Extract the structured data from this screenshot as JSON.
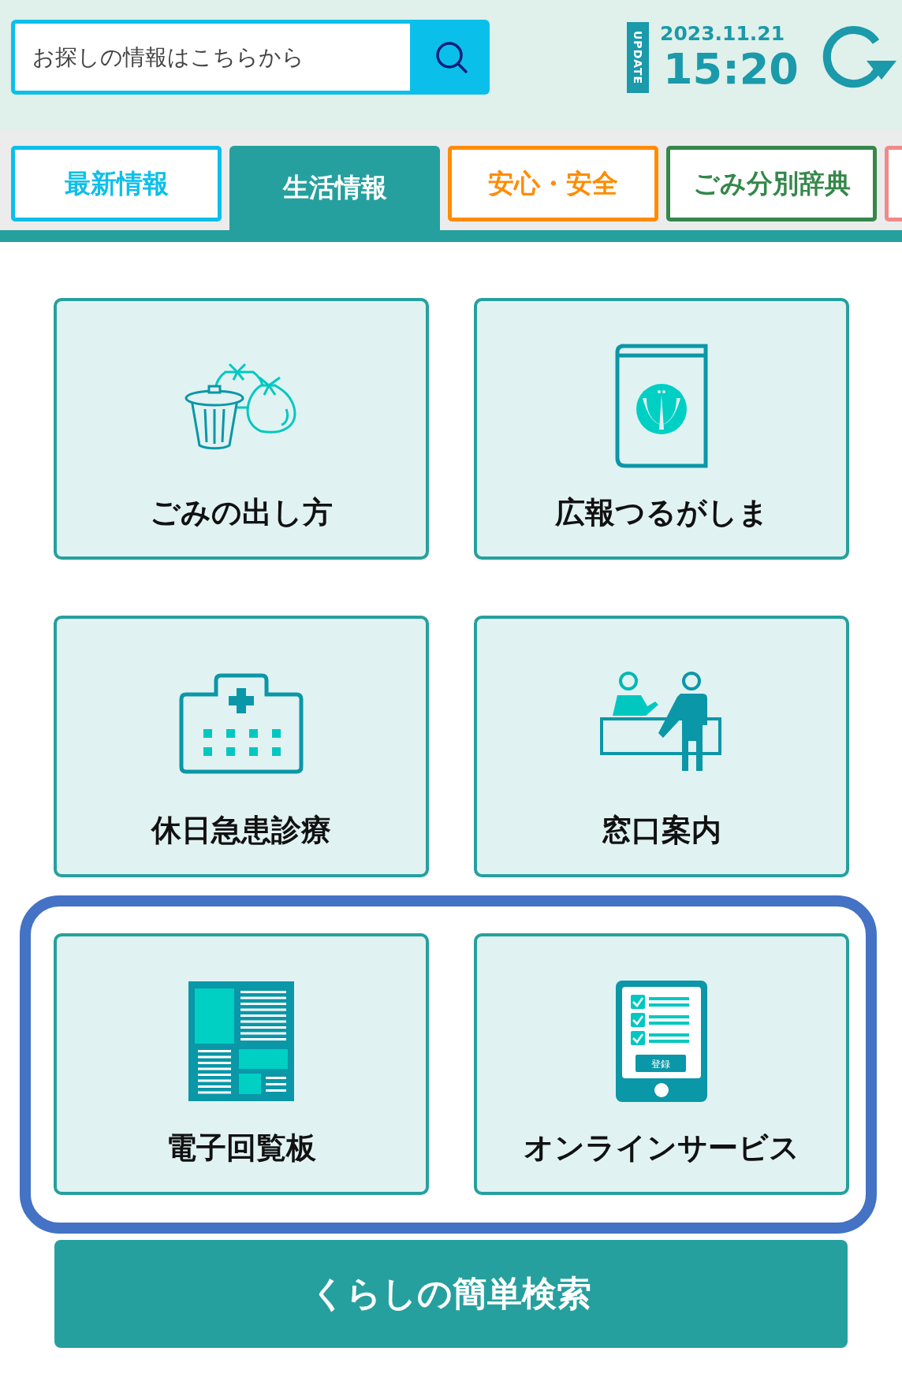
{
  "search": {
    "placeholder": "お探しの情報はこちらから"
  },
  "update": {
    "badge": "UPDATE",
    "date": "2023.11.21",
    "time": "15:20"
  },
  "tabs": [
    {
      "label": "最新情報",
      "selected": false,
      "color": "#0bbfeb"
    },
    {
      "label": "生活情報",
      "selected": true,
      "color": "#26a09e"
    },
    {
      "label": "安心・安全",
      "selected": false,
      "color": "#ff8c00"
    },
    {
      "label": "ごみ分別辞典",
      "selected": false,
      "color": "#35874a"
    },
    {
      "selected": false,
      "color": "#f08a8a"
    }
  ],
  "card_rows": [
    {
      "highlighted": false,
      "cards": [
        {
          "kind": "garbage",
          "label": "ごみの出し方"
        },
        {
          "kind": "magazine",
          "label": "広報つるがしま"
        }
      ]
    },
    {
      "highlighted": false,
      "cards": [
        {
          "kind": "hospital",
          "label": "休日急患診療"
        },
        {
          "kind": "reception",
          "label": "窓口案内"
        }
      ]
    },
    {
      "highlighted": true,
      "cards": [
        {
          "kind": "newspaper",
          "label": "電子回覧板"
        },
        {
          "kind": "tablet",
          "label": "オンラインサービス",
          "icon_text": "登録"
        }
      ]
    }
  ],
  "search_button": {
    "label": "くらしの簡単検索"
  }
}
